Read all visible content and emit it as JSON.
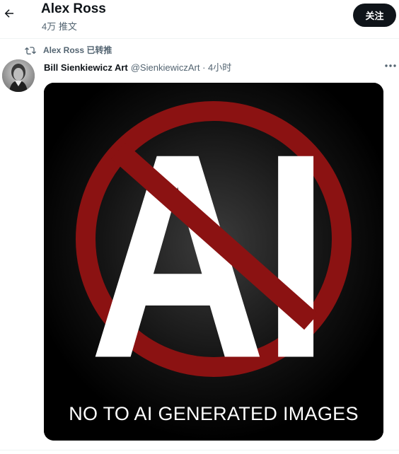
{
  "header": {
    "title": "Alex Ross",
    "post_count": "4万 推文",
    "follow_label": "关注"
  },
  "retweet": {
    "text": "Alex Ross 已转推"
  },
  "tweet": {
    "author_name": "Bill Sienkiewicz Art",
    "handle_time": "@SienkiewiczArt · 4小时",
    "media": {
      "big_text": "AI",
      "caption": "NO TO AI GENERATED IMAGES"
    }
  },
  "icons": {
    "back": "arrow-left-icon",
    "retweet": "retweet-icon",
    "more": "more-horizontal-icon"
  },
  "colors": {
    "follow_bg": "#0f1419",
    "prohibition_red": "#8b1212",
    "secondary_text": "#536471"
  }
}
